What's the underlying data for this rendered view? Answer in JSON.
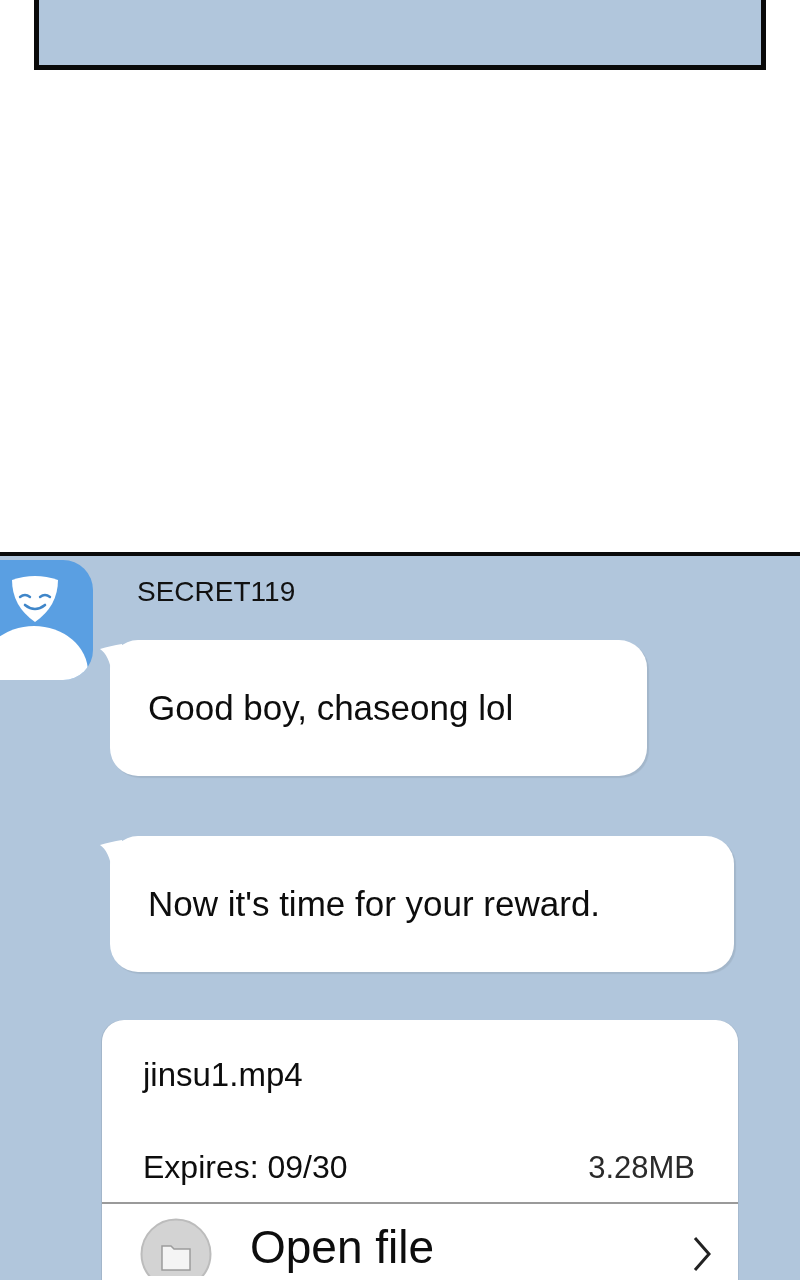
{
  "sender": {
    "name": "SECRET119"
  },
  "messages": [
    {
      "kind": "text",
      "text": "Good boy, chaseong lol"
    },
    {
      "kind": "text",
      "text": "Now it's time for your reward."
    },
    {
      "kind": "file",
      "file_name": "jinsu1.mp4",
      "expiry": "Expires: 09/30",
      "size": "3.28MB",
      "action": "Open file"
    }
  ]
}
